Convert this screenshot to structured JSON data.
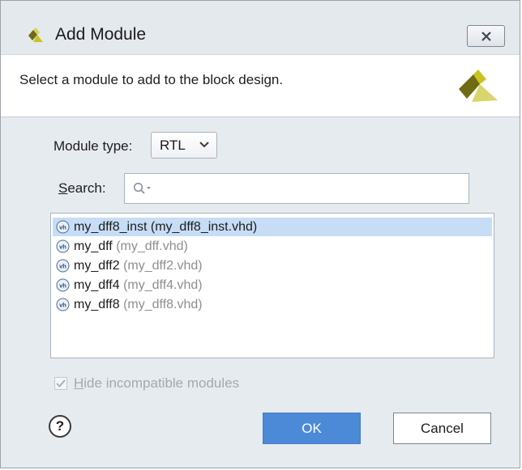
{
  "window": {
    "title": "Add Module"
  },
  "header": {
    "description": "Select a module to add to the block design."
  },
  "module_type": {
    "label": "Module type:",
    "value": "RTL"
  },
  "search": {
    "label_rest": "earch:",
    "label_mnemonic": "S",
    "placeholder": ""
  },
  "modules": [
    {
      "name": "my_dff8_inst",
      "file": "(my_dff8_inst.vhd)",
      "selected": true
    },
    {
      "name": "my_dff",
      "file": "(my_dff.vhd)",
      "selected": false
    },
    {
      "name": "my_dff2",
      "file": "(my_dff2.vhd)",
      "selected": false
    },
    {
      "name": "my_dff4",
      "file": "(my_dff4.vhd)",
      "selected": false
    },
    {
      "name": "my_dff8",
      "file": "(my_dff8.vhd)",
      "selected": false
    }
  ],
  "options": {
    "hide_mnemonic": "H",
    "hide_rest": "ide incompatible modules",
    "hide_checked": true
  },
  "buttons": {
    "help": "?",
    "ok": "OK",
    "cancel": "Cancel"
  },
  "icons": {
    "app": "xilinx-logo-icon",
    "close": "close-icon",
    "module": "vhdl-file-icon",
    "search": "search-icon",
    "dropdown": "chevron-down-icon"
  },
  "colors": {
    "accent": "#4c8ad8",
    "selection": "#c7ddf6",
    "logo_yellow": "#c8c41c",
    "logo_olive": "#6e6b14"
  }
}
